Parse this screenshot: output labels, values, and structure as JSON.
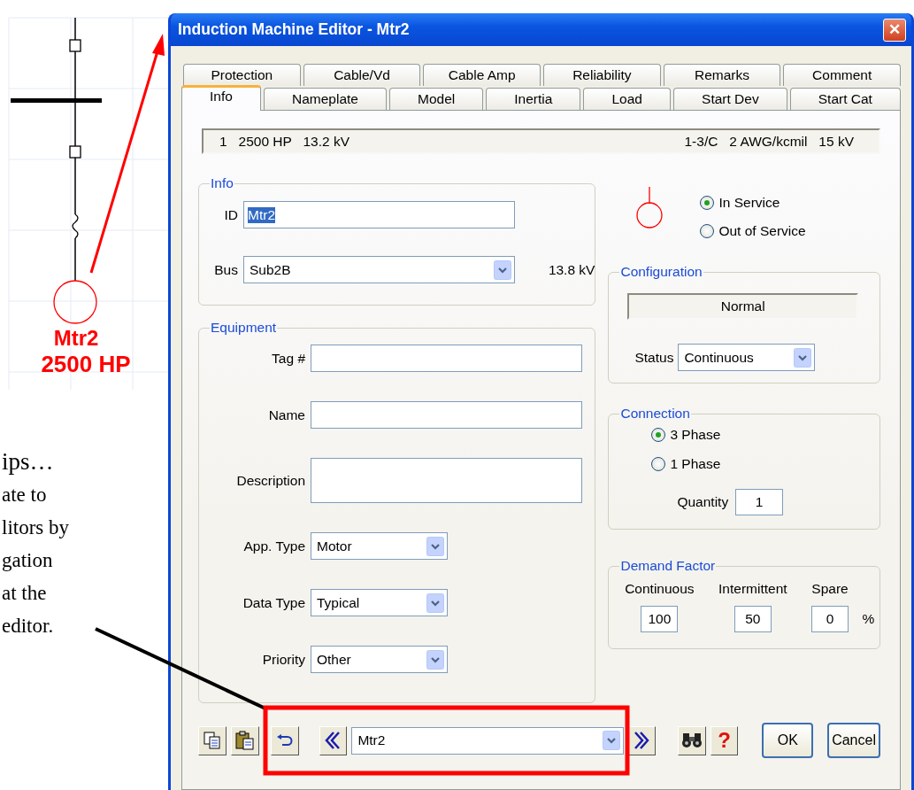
{
  "diagram": {
    "motor_label": "Mtr2",
    "motor_rating": "2500 HP"
  },
  "tip_lines": [
    "ips…",
    "ate to",
    "litors by",
    "gation",
    "at the",
    "editor."
  ],
  "window": {
    "title": "Induction Machine Editor - Mtr2",
    "close": "✕"
  },
  "tab_rows": [
    [
      {
        "label": "Protection",
        "selected": false
      },
      {
        "label": "Cable/Vd",
        "selected": false
      },
      {
        "label": "Cable Amp",
        "selected": false
      },
      {
        "label": "Reliability",
        "selected": false
      },
      {
        "label": "Remarks",
        "selected": false
      },
      {
        "label": "Comment",
        "selected": false
      }
    ],
    [
      {
        "label": "Info",
        "selected": true
      },
      {
        "label": "Nameplate",
        "selected": false
      },
      {
        "label": "Model",
        "selected": false
      },
      {
        "label": "Inertia",
        "selected": false
      },
      {
        "label": "Load",
        "selected": false
      },
      {
        "label": "Start Dev",
        "selected": false
      },
      {
        "label": "Start Cat",
        "selected": false
      }
    ]
  ],
  "summary": {
    "left": "1   2500 HP   13.2 kV",
    "right": "1-3/C   2 AWG/kcmil   15 kV"
  },
  "info": {
    "title": "Info",
    "id": {
      "label": "ID",
      "value": "Mtr2",
      "text_selected": true
    },
    "bus": {
      "label": "Bus",
      "value": "Sub2B",
      "voltage": "13.8 kV"
    }
  },
  "service": [
    {
      "label": "In Service",
      "selected": true
    },
    {
      "label": "Out of Service",
      "selected": false
    }
  ],
  "equipment": {
    "title": "Equipment",
    "fields": [
      {
        "kind": "text",
        "label": "Tag #"
      },
      {
        "kind": "text",
        "label": "Name"
      },
      {
        "kind": "textarea",
        "label": "Description"
      },
      {
        "kind": "select",
        "label": "App. Type",
        "value": "Motor"
      },
      {
        "kind": "select",
        "label": "Data Type",
        "value": "Typical"
      },
      {
        "kind": "select",
        "label": "Priority",
        "value": "Other"
      }
    ]
  },
  "configuration": {
    "title": "Configuration",
    "mode": "Normal",
    "status_label": "Status",
    "status": "Continuous"
  },
  "connection": {
    "title": "Connection",
    "phases": [
      {
        "label": "3 Phase",
        "selected": true
      },
      {
        "label": "1 Phase",
        "selected": false
      }
    ],
    "quantity_label": "Quantity",
    "quantity": "1"
  },
  "demand_factor": {
    "title": "Demand Factor",
    "columns": [
      {
        "label": "Continuous",
        "value": "100"
      },
      {
        "label": "Intermittent",
        "value": "50"
      },
      {
        "label": "Spare",
        "value": "0"
      }
    ],
    "unit": "%"
  },
  "navigator": {
    "value": "Mtr2"
  },
  "help_button": "?",
  "buttons": [
    "OK",
    "Cancel"
  ]
}
